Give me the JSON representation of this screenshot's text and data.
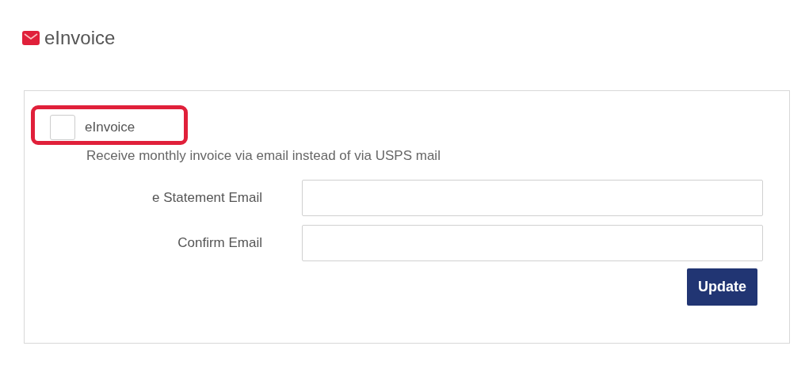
{
  "header": {
    "title": "eInvoice"
  },
  "option": {
    "label": "eInvoice",
    "checked": false,
    "highlighted": true,
    "description": "Receive monthly invoice via email instead of via USPS mail"
  },
  "fields": [
    {
      "label": "e Statement Email"
    },
    {
      "label": "Confirm Email"
    }
  ],
  "button": "Update"
}
